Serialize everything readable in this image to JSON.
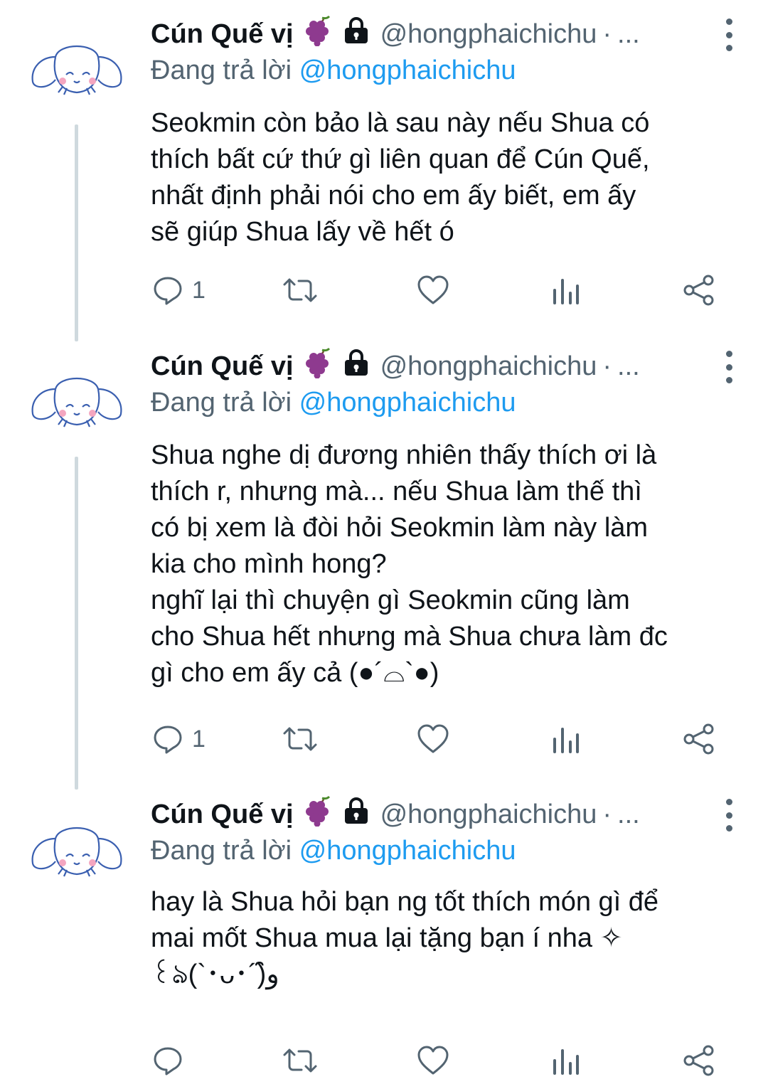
{
  "tweets": [
    {
      "author_name": "Cún Quế vị",
      "handle": "@hongphaichichu",
      "separator": "·",
      "truncation": "...",
      "replying_prefix": "Đang trả lời",
      "replying_to": "@hongphaichichu",
      "text": "Seokmin còn bảo là sau này nếu Shua có\nthích bất cứ thứ gì liên quan để Cún Quế,\nnhất định phải nói cho em ấy biết, em ấy\nsẽ giúp Shua lấy về hết ó",
      "reply_count": "1"
    },
    {
      "author_name": "Cún Quế vị",
      "handle": "@hongphaichichu",
      "separator": "·",
      "truncation": "...",
      "replying_prefix": "Đang trả lời",
      "replying_to": "@hongphaichichu",
      "text": "Shua nghe dị đương nhiên thấy thích ơi là\nthích r, nhưng mà... nếu Shua làm thế thì\ncó bị xem là đòi hỏi Seokmin làm này làm\nkia cho mình hong?\nnghĩ lại thì chuyện gì Seokmin cũng làm\ncho Shua hết nhưng mà Shua chưa làm đc\ngì cho em ấy cả (●´⌓`●)",
      "reply_count": "1"
    },
    {
      "author_name": "Cún Quế vị",
      "handle": "@hongphaichichu",
      "separator": "·",
      "truncation": "...",
      "replying_prefix": "Đang trả lời",
      "replying_to": "@hongphaichichu",
      "text": "hay là Shua hỏi bạn ng tốt thích món gì để\nmai mốt Shua mua lại tặng bạn í nha ✧\n꒰ঌ(`･ᴗ･´)و̑̑",
      "reply_count": ""
    }
  ],
  "icons": {
    "avatar": "cinnamoroll-avatar",
    "grapes": "grapes-emoji",
    "lock": "lock-icon",
    "more": "more-vertical-icon",
    "reply": "reply-icon",
    "retweet": "retweet-icon",
    "like": "heart-icon",
    "views": "analytics-icon",
    "share": "share-icon"
  },
  "colors": {
    "text": "#0f1419",
    "secondary": "#536471",
    "link": "#1d9bf0",
    "thread_line": "#cfd9de",
    "grapes": "#8e3a8f"
  }
}
